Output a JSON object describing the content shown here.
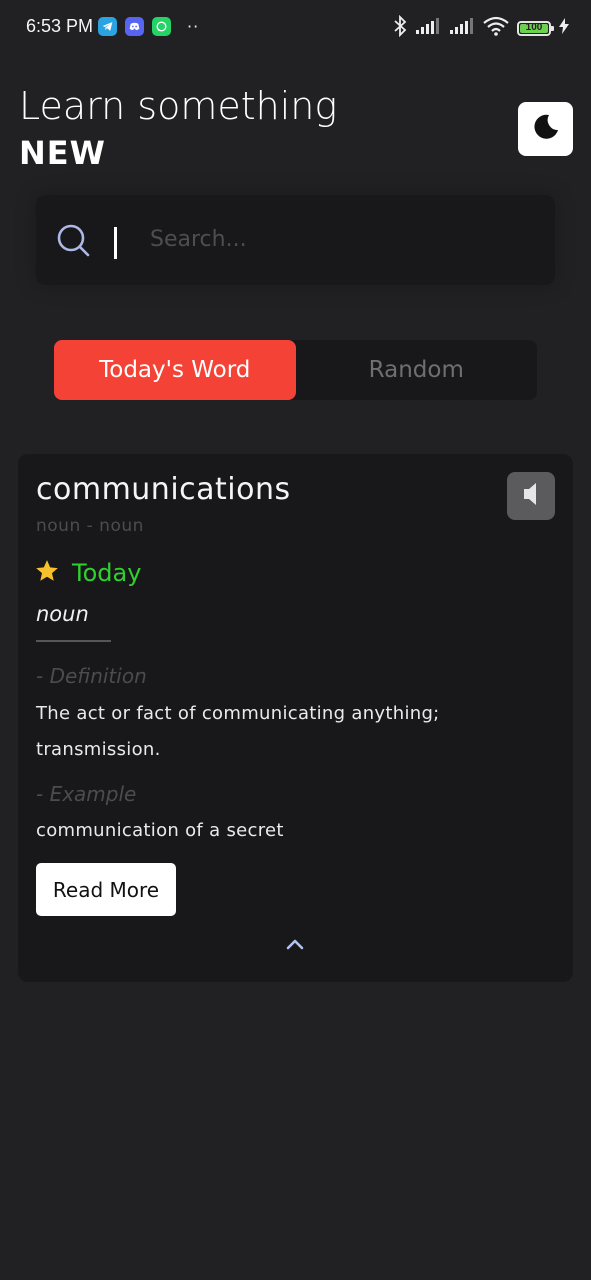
{
  "status_bar": {
    "time": "6:53 PM",
    "notification_icons": [
      "telegram-icon",
      "discord-icon",
      "whatsapp-icon"
    ],
    "more": "··",
    "system_icons": [
      "bluetooth-icon",
      "signal-icon",
      "signal-icon",
      "wifi-icon",
      "battery-icon",
      "charging-icon"
    ],
    "battery_level": "100"
  },
  "header": {
    "title": "Learn something",
    "emphasis": "NEW",
    "theme_toggle_icon": "moon-icon"
  },
  "search": {
    "placeholder": "Search...",
    "value": "",
    "icon": "search-icon"
  },
  "tabs": [
    {
      "label": "Today's Word",
      "active": true
    },
    {
      "label": "Random",
      "active": false
    }
  ],
  "card": {
    "word": "communications",
    "phonetic": "noun - noun",
    "audio_icon": "speaker-icon",
    "badge_icon": "star-icon",
    "badge_text": "Today",
    "part_of_speech": "noun",
    "definition_label": "- Definition",
    "definition": "The act or fact of communicating anything; transmission.",
    "example_label": "- Example",
    "example": "communication of a secret",
    "read_more": "Read More",
    "collapse_icon": "chevron-up-icon"
  },
  "colors": {
    "background": "#212123",
    "surface": "#18181a",
    "accent": "#f44336",
    "today_green": "#2fd12f",
    "star": "#f7c12c"
  }
}
